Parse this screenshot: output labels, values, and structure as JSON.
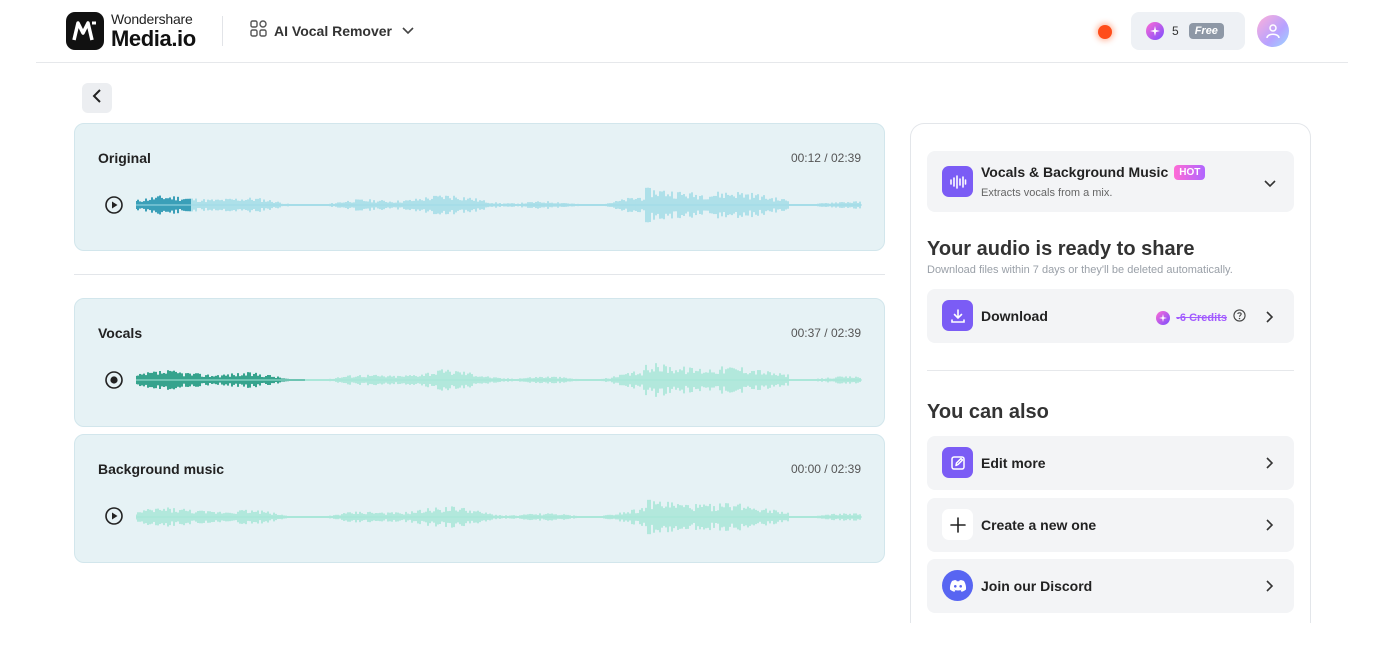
{
  "header": {
    "brand_small": "Wondershare",
    "brand_big": "Media.io",
    "tool_name": "AI Vocal Remover",
    "credits": "5",
    "plan_badge": "Free"
  },
  "tracks": [
    {
      "title": "Original",
      "time": "00:12 / 02:39",
      "state": "play",
      "progress": 0.075,
      "played_color": "#0e8aa8",
      "wave_color": "#9fdbe6"
    },
    {
      "title": "Vocals",
      "time": "00:37 / 02:39",
      "state": "playing",
      "progress": 0.232,
      "played_color": "#0a8f73",
      "wave_color": "#a4e6d6"
    },
    {
      "title": "Background music",
      "time": "00:00 / 02:39",
      "state": "play",
      "progress": 0,
      "played_color": "#0a8f73",
      "wave_color": "#a4e6d6"
    }
  ],
  "panel": {
    "mode": {
      "title": "Vocals & Background Music",
      "badge": "HOT",
      "subtitle": "Extracts vocals from a mix."
    },
    "ready_title": "Your audio is ready to share",
    "ready_subtitle": "Download files within 7 days or they'll be deleted automatically.",
    "download": {
      "label": "Download",
      "credits": "-6 Credits"
    },
    "also_title": "You can also",
    "actions": [
      {
        "label": "Edit more",
        "icon": "edit-icon"
      },
      {
        "label": "Create a new one",
        "icon": "plus-icon"
      },
      {
        "label": "Join our Discord",
        "icon": "discord-icon"
      }
    ]
  },
  "colors": {
    "accent": "#7b5cf5",
    "discord": "#5865f2",
    "hot_badge": "#ff6bd5"
  }
}
